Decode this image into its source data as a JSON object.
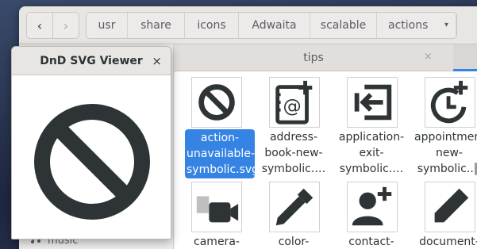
{
  "headerbar": {
    "back_glyph": "‹",
    "forward_glyph": "›",
    "path": [
      "usr",
      "share",
      "icons",
      "Adwaita",
      "scalable",
      "actions"
    ],
    "path_menu_glyph": "▾"
  },
  "tab": {
    "title": "tips",
    "close_glyph": "×"
  },
  "sidebar": {
    "visible_item": "music",
    "visible_item_icon": "music-icon"
  },
  "files": [
    {
      "label": "action-unavailable-symbolic.svg",
      "icon": "forbidden-icon",
      "selected": true
    },
    {
      "label": "address-book-new-symbolic.…",
      "icon": "address-book-new-icon"
    },
    {
      "label": "application-exit-symbolic.…",
      "icon": "application-exit-icon"
    },
    {
      "label": "appointment-new-symbolic.…",
      "icon": "appointment-new-icon"
    },
    {
      "label": "camera-",
      "icon": "camera-icon"
    },
    {
      "label": "color-",
      "icon": "color-picker-icon"
    },
    {
      "label": "contact-",
      "icon": "contact-new-icon"
    },
    {
      "label": "document-",
      "icon": "document-edit-icon"
    }
  ],
  "viewer": {
    "title": "DnD SVG Viewer",
    "close_glyph": "×",
    "icon": "forbidden-icon"
  },
  "colors": {
    "accent": "#3584e4",
    "icon": "#2e3436"
  }
}
